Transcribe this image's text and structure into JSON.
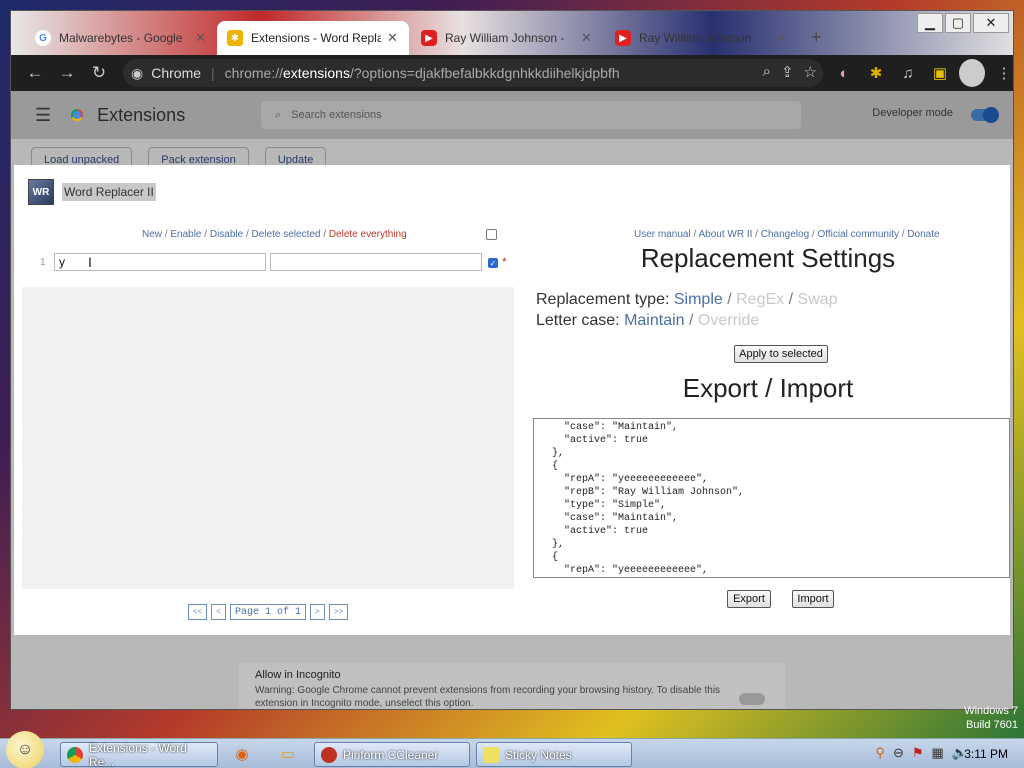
{
  "browser": {
    "tabs": [
      {
        "title": "Malwarebytes - Google",
        "active": false,
        "icon": "google-icon"
      },
      {
        "title": "Extensions - Word Repla",
        "active": true,
        "icon": "puzzle-icon"
      },
      {
        "title": "Ray William Johnson - ",
        "active": false,
        "icon": "youtube-icon"
      },
      {
        "title": "Ray William Johnson",
        "active": false,
        "icon": "youtube-icon"
      }
    ],
    "omnibox": {
      "chip": "Chrome",
      "url_prefix": "chrome://",
      "url_host": "extensions",
      "url_rest": "/?options=djakfbefalbkkdgnhkkdiihelkjdpbfh"
    }
  },
  "extensions_page": {
    "title": "Extensions",
    "search_placeholder": "Search extensions",
    "developer_mode_label": "Developer mode",
    "actions": [
      "Load unpacked",
      "Pack extension",
      "Update"
    ],
    "allow_incognito_title": "Allow in Incognito",
    "allow_incognito_warning": "Warning: Google Chrome cannot prevent extensions from recording your browsing history. To disable this extension in Incognito mode, unselect this option."
  },
  "dialog": {
    "icon_text": "WR",
    "title": "Word Replacer II",
    "action_links": {
      "new": "New",
      "enable": "Enable",
      "disable": "Disable",
      "delete_selected": "Delete selected",
      "delete_everything": "Delete everything"
    },
    "rule": {
      "num": "1",
      "from": "y",
      "to": "",
      "star": "*"
    },
    "pager": {
      "first": "<<",
      "prev": "<",
      "page": "Page 1 of 1",
      "next": ">",
      "last": ">>"
    },
    "doc_links": {
      "manual": "User manual",
      "about": "About WR II",
      "changelog": "Changelog",
      "community": "Official community",
      "donate": "Donate"
    },
    "settings_title": "Replacement Settings",
    "replacement_type_label": "Replacement type:",
    "type_simple": "Simple",
    "type_regex": "RegEx",
    "type_swap": "Swap",
    "letter_case_label": "Letter case:",
    "case_maintain": "Maintain",
    "case_override": "Override",
    "apply_button": "Apply to selected",
    "export_import_title": "Export / Import",
    "json_text": "    \"case\": \"Maintain\",\n    \"active\": true\n  },\n  {\n    \"repA\": \"yeeeeeeeeeeee\",\n    \"repB\": \"Ray William Johnson\",\n    \"type\": \"Simple\",\n    \"case\": \"Maintain\",\n    \"active\": true\n  },\n  {\n    \"repA\": \"yeeeeeeeeeeee\",",
    "export_button": "Export",
    "import_button": "Import"
  },
  "taskbar": {
    "items": [
      {
        "label": "Extensions - Word Re...",
        "icon": "chrome-icon"
      },
      {
        "label": "Piriform CCleaner",
        "icon": "ccleaner-icon"
      },
      {
        "label": "Sticky Notes",
        "icon": "sticky-notes-icon"
      }
    ],
    "clock": "3:11 PM",
    "watermark_line1": "Windows 7",
    "watermark_line2": "Build 7601"
  },
  "colors": {
    "link_blue": "#4a6fa5",
    "danger_red": "#c0392b",
    "disabled_grey": "#c8c8c8"
  }
}
